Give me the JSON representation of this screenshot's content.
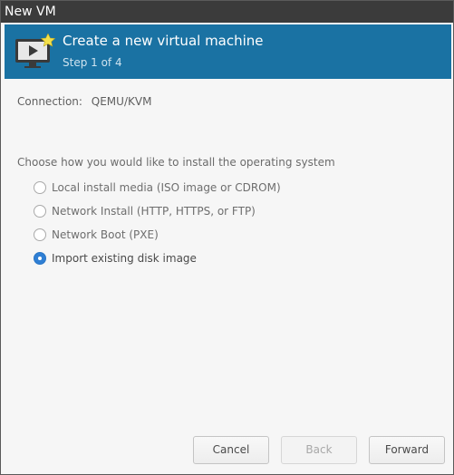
{
  "window": {
    "title": "New VM"
  },
  "header": {
    "icon": "vm-monitor-icon",
    "title": "Create a new virtual machine",
    "step": "Step 1 of 4"
  },
  "connection": {
    "label": "Connection:",
    "value": "QEMU/KVM"
  },
  "install": {
    "question": "Choose how you would like to install the operating system",
    "options": [
      {
        "label": "Local install media (ISO image or CDROM)",
        "selected": false
      },
      {
        "label": "Network Install (HTTP, HTTPS, or FTP)",
        "selected": false
      },
      {
        "label": "Network Boot (PXE)",
        "selected": false
      },
      {
        "label": "Import existing disk image",
        "selected": true
      }
    ]
  },
  "buttons": {
    "cancel": "Cancel",
    "back": "Back",
    "forward": "Forward",
    "back_enabled": false
  },
  "colors": {
    "header_bg": "#1a72a3",
    "titlebar_bg": "#3b3b3b",
    "radio_selected": "#2f7fd4"
  }
}
